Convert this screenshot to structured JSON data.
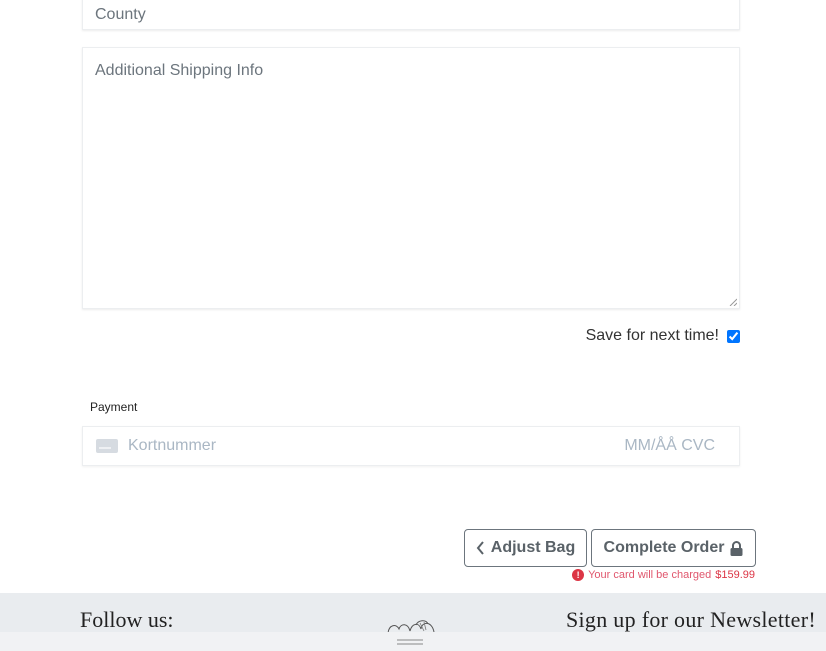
{
  "form": {
    "county_placeholder": "County",
    "shipping_placeholder": "Additional Shipping Info",
    "save_label": "Save for next time!",
    "save_checked": true
  },
  "payment": {
    "label": "Payment",
    "card_number_placeholder": "Kortnummer",
    "expiry_cvc_placeholder": "MM/ÅÅ CVC"
  },
  "actions": {
    "adjust_bag_label": "Adjust Bag",
    "complete_order_label": "Complete Order",
    "charge_note": "Your card will be charged",
    "charge_amount": "$159.99"
  },
  "footer": {
    "follow_label": "Follow us:",
    "newsletter_label": "Sign up for our Newsletter!"
  },
  "icons": [
    "card-icon",
    "chevron-left-icon",
    "lock-icon",
    "alert-icon",
    "logo-icon",
    "drag-handle-icon"
  ],
  "colors": {
    "alert": "#dc3545",
    "button_text": "#5a6268",
    "footer_bg": "#e9ecef"
  }
}
